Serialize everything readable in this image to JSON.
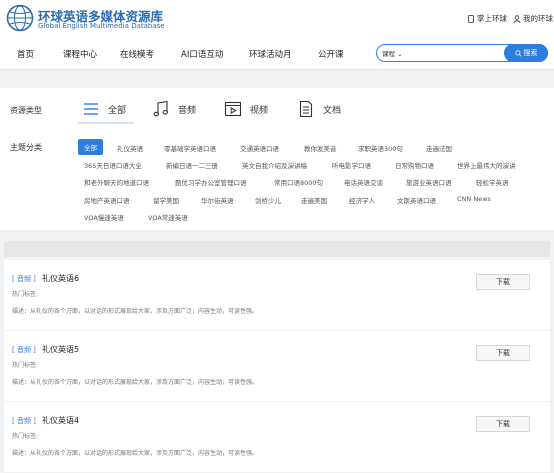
{
  "header": {
    "title": "环球英语多媒体资源库",
    "subtitle": "Global English Multimedia Database",
    "mobile_label": "掌上环球",
    "account_label": "我的环球"
  },
  "nav": {
    "items": [
      "首页",
      "课程中心",
      "在线模考",
      "AI口语互动",
      "环球活动月",
      "公开课"
    ]
  },
  "search": {
    "category": "课程",
    "placeholder": "",
    "button_label": "搜索"
  },
  "filters": {
    "type_label": "资源类型",
    "types": [
      "全部",
      "音频",
      "视频",
      "文档"
    ],
    "topic_label": "主题分类",
    "topics": [
      "全部",
      "礼仪英语",
      "零基础学英语口语",
      "交通英语口语",
      "教你发美音",
      "求职英语300句",
      "走遍法国",
      "365天日语口语大全",
      "新编日语一二三册",
      "英文自我介绍及演讲稿",
      "听电影学口语",
      "日常购物口语",
      "世界上最伟大的演讲",
      "和老外聊天的地道口语",
      "题优习学办公室管理口语",
      "常用口语8000句",
      "电话英语交谈",
      "旅游业英语口语",
      "轻松学英语",
      "房地产英语口语",
      "留学美国",
      "华尔街英语",
      "剑桥少儿",
      "走遍美国",
      "经济学人",
      "文斯英语口语",
      "CNN News",
      "VOA慢速英语",
      "VOA常速英语"
    ]
  },
  "resources": [
    {
      "type": "[ 音频 ]",
      "title": "礼仪英语6",
      "tags": "热门标签:",
      "desc": "描述：从礼仪的各个方面，以对话的形式展现给大家，涉及方面广泛，内容生动，可读性强。",
      "button": "下载"
    },
    {
      "type": "[ 音频 ]",
      "title": "礼仪英语5",
      "tags": "热门标签:",
      "desc": "描述：从礼仪的各个方面，以对话的形式展现给大家，涉及方面广泛，内容生动，可读性强。",
      "button": "下载"
    },
    {
      "type": "[ 音频 ]",
      "title": "礼仪英语4",
      "tags": "热门标签:",
      "desc": "描述：从礼仪的各个方面，以对话的形式展现给大家，涉及方面广泛，内容生动，可读性强。",
      "button": "下载"
    }
  ],
  "colors": {
    "accent": "#2f7de1",
    "brand": "#2a6cb1"
  }
}
